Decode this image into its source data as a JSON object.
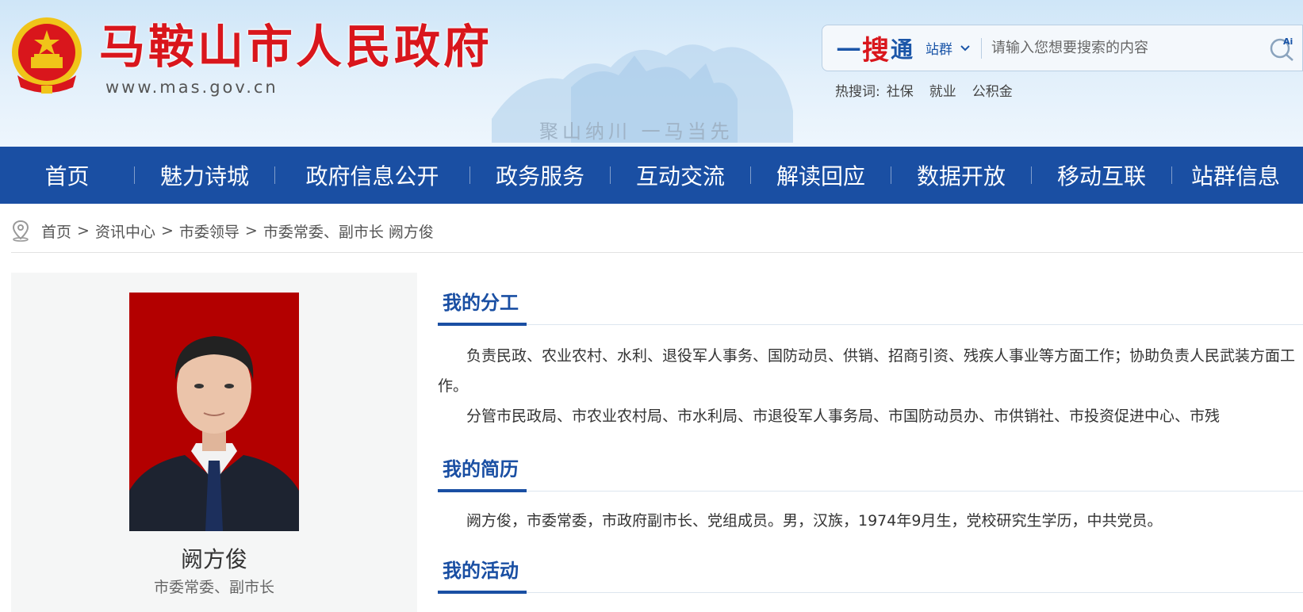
{
  "header": {
    "site_title": "马鞍山市人民政府",
    "site_domain": "www.mas.gov.cn",
    "slogan": "聚山纳川 一马当先"
  },
  "search": {
    "brand_yi": "一",
    "brand_sou": "搜",
    "brand_tong": "通",
    "scope_label": "站群",
    "placeholder": "请输入您想要搜索的内容"
  },
  "hot_words": {
    "label": "热搜词:",
    "items": [
      "社保",
      "就业",
      "公积金"
    ]
  },
  "nav": {
    "items": [
      "首页",
      "魅力诗城",
      "政府信息公开",
      "政务服务",
      "互动交流",
      "解读回应",
      "数据开放",
      "移动互联",
      "站群信息"
    ]
  },
  "breadcrumb": {
    "items": [
      "首页",
      "资讯中心",
      "市委领导",
      "市委常委、副市长 阙方俊"
    ],
    "separator": ">"
  },
  "profile": {
    "name": "阙方俊",
    "title": "市委常委、副市长"
  },
  "sections": {
    "duty_title": "我的分工",
    "duty_p1": "负责民政、农业农村、水利、退役军人事务、国防动员、供销、招商引资、残疾人事业等方面工作；协助负责人民武装方面工作。",
    "duty_p2": "分管市民政局、市农业农村局、市水利局、市退役军人事务局、市国防动员办、市供销社、市投资促进中心、市残",
    "bio_title": "我的简历",
    "bio_p": "阙方俊，市委常委，市政府副市长、党组成员。男，汉族，1974年9月生，党校研究生学历，中共党员。",
    "activity_title": "我的活动"
  },
  "colors": {
    "nav_blue": "#1a4fa3",
    "title_red": "#d9161c",
    "photo_bg": "#b30000"
  }
}
